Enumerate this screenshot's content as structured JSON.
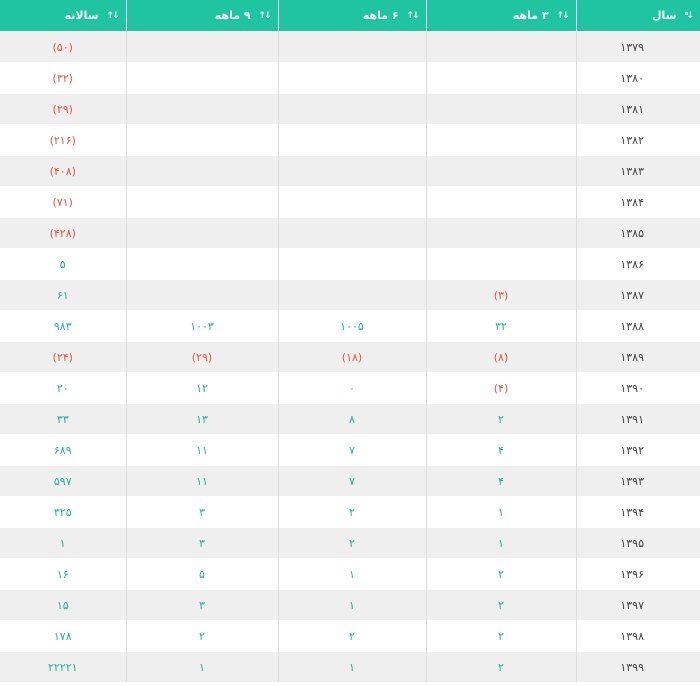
{
  "headers": {
    "year": "سال",
    "q3": "۳ ماهه",
    "q6": "۶ ماهه",
    "q9": "۹ ماهه",
    "annual": "سالانه"
  },
  "sort_icons": {
    "year": "sort-ascending-icon",
    "others": "sort-both-icon"
  },
  "colors": {
    "header_bg": "#1fc4a0",
    "positive": "#1fb39a",
    "negative": "#e8553f",
    "stripe": "#efefef"
  },
  "rows": [
    {
      "year": "۱۳۷۹",
      "q3": "",
      "q6": "",
      "q9": "",
      "annual": "(۵۰)"
    },
    {
      "year": "۱۳۸۰",
      "q3": "",
      "q6": "",
      "q9": "",
      "annual": "(۳۲)"
    },
    {
      "year": "۱۳۸۱",
      "q3": "",
      "q6": "",
      "q9": "",
      "annual": "(۲۹)"
    },
    {
      "year": "۱۳۸۲",
      "q3": "",
      "q6": "",
      "q9": "",
      "annual": "(۲۱۶)"
    },
    {
      "year": "۱۳۸۳",
      "q3": "",
      "q6": "",
      "q9": "",
      "annual": "(۴۰۸)"
    },
    {
      "year": "۱۳۸۴",
      "q3": "",
      "q6": "",
      "q9": "",
      "annual": "(۷۱)"
    },
    {
      "year": "۱۳۸۵",
      "q3": "",
      "q6": "",
      "q9": "",
      "annual": "(۴۲۸)"
    },
    {
      "year": "۱۳۸۶",
      "q3": "",
      "q6": "",
      "q9": "",
      "annual": "۵"
    },
    {
      "year": "۱۳۸۷",
      "q3": "(۳)",
      "q6": "",
      "q9": "",
      "annual": "۶۱"
    },
    {
      "year": "۱۳۸۸",
      "q3": "۳۲",
      "q6": "۱۰۰۵",
      "q9": "۱۰۰۳",
      "annual": "۹۸۳"
    },
    {
      "year": "۱۳۸۹",
      "q3": "(۸)",
      "q6": "(۱۸)",
      "q9": "(۲۹)",
      "annual": "(۲۴)"
    },
    {
      "year": "۱۳۹۰",
      "q3": "(۴)",
      "q6": "۰",
      "q9": "۱۲",
      "annual": "۲۰"
    },
    {
      "year": "۱۳۹۱",
      "q3": "۲",
      "q6": "۸",
      "q9": "۱۳",
      "annual": "۳۳"
    },
    {
      "year": "۱۳۹۲",
      "q3": "۴",
      "q6": "۷",
      "q9": "۱۱",
      "annual": "۶۸۹"
    },
    {
      "year": "۱۳۹۳",
      "q3": "۴",
      "q6": "۷",
      "q9": "۱۱",
      "annual": "۵۹۷"
    },
    {
      "year": "۱۳۹۴",
      "q3": "۱",
      "q6": "۲",
      "q9": "۳",
      "annual": "۳۲۵"
    },
    {
      "year": "۱۳۹۵",
      "q3": "۱",
      "q6": "۲",
      "q9": "۳",
      "annual": "۱"
    },
    {
      "year": "۱۳۹۶",
      "q3": "۲",
      "q6": "۱",
      "q9": "۵",
      "annual": "۱۶"
    },
    {
      "year": "۱۳۹۷",
      "q3": "۲",
      "q6": "۱",
      "q9": "۳",
      "annual": "۱۵"
    },
    {
      "year": "۱۳۹۸",
      "q3": "۲",
      "q6": "۲",
      "q9": "۲",
      "annual": "۱۷۸"
    },
    {
      "year": "۱۳۹۹",
      "q3": "۲",
      "q6": "۱",
      "q9": "۱",
      "annual": "۲۲۲۲۱"
    }
  ]
}
